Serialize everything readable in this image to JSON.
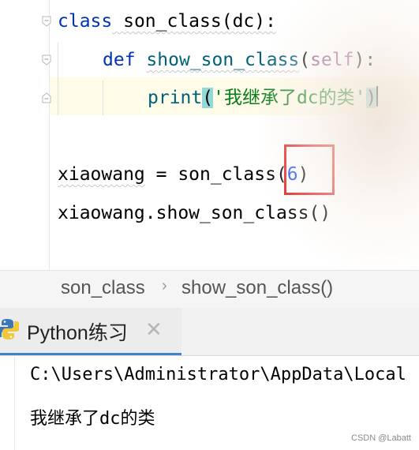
{
  "editor": {
    "lines": {
      "l1": {
        "kw": "class",
        "rest": " son_class(dc):"
      },
      "l2": {
        "kw": "def",
        "fn": "show_son_class",
        "open": "(",
        "self": "self",
        "close": "):"
      },
      "l3": {
        "print": "print",
        "open": "(",
        "str": "'我继承了dc的类'",
        "close": ")"
      },
      "l4": {
        "name": "xiaowang",
        "mid": " = son_class(",
        "num": "6",
        "close": ")"
      },
      "l5": {
        "text": "xiaowang.show_son_class()"
      }
    }
  },
  "breadcrumb": {
    "items": [
      "son_class",
      "show_son_class()"
    ],
    "separator": "›"
  },
  "run_panel": {
    "tab_label": "Python练习",
    "close_glyph": "✕",
    "output": [
      "C:\\Users\\Administrator\\AppData\\Local",
      "我继承了dc的类"
    ]
  },
  "watermark": "CSDN @Labatt",
  "colors": {
    "keyword": "#0033b3",
    "function": "#00627a",
    "self": "#94558d",
    "string": "#067d17",
    "number": "#1750eb",
    "paren_highlight": "#93d9d9",
    "annotation_box": "#e02020",
    "tab_underline": "#4083c9"
  }
}
